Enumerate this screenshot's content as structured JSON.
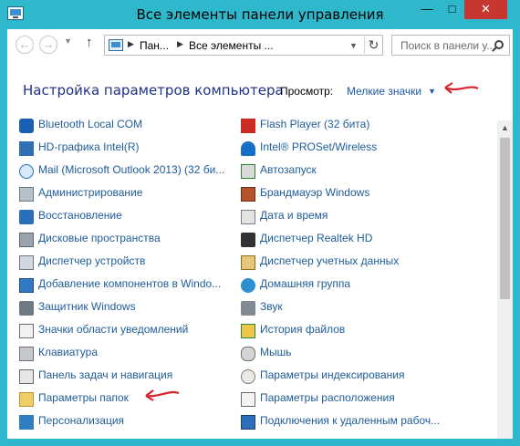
{
  "window": {
    "title": "Все элементы панели управления",
    "controls": {
      "minimize": "—",
      "maximize": "□",
      "close": "✕"
    }
  },
  "addressbar": {
    "crumbs": [
      "Пан...",
      "Все элементы ..."
    ],
    "search_placeholder": "Поиск в панели у..."
  },
  "header": {
    "title": "Настройка параметров компьютера",
    "view_label": "Просмотр:",
    "view_value": "Мелкие значки"
  },
  "items_left": [
    {
      "label": "Bluetooth Local COM",
      "icon": "bluetooth-icon"
    },
    {
      "label": "HD-графика Intel(R)",
      "icon": "intel-graphics-icon"
    },
    {
      "label": "Mail (Microsoft Outlook 2013) (32 би...",
      "icon": "mail-icon"
    },
    {
      "label": "Администрирование",
      "icon": "administrative-tools-icon"
    },
    {
      "label": "Восстановление",
      "icon": "recovery-icon"
    },
    {
      "label": "Дисковые пространства",
      "icon": "storage-spaces-icon"
    },
    {
      "label": "Диспетчер устройств",
      "icon": "device-manager-icon"
    },
    {
      "label": "Добавление компонентов в Windo...",
      "icon": "add-features-icon"
    },
    {
      "label": "Защитник Windows",
      "icon": "windows-defender-icon"
    },
    {
      "label": "Значки области уведомлений",
      "icon": "notification-area-icon"
    },
    {
      "label": "Клавиатура",
      "icon": "keyboard-icon"
    },
    {
      "label": "Панель задач и навигация",
      "icon": "taskbar-icon"
    },
    {
      "label": "Параметры папок",
      "icon": "folder-options-icon"
    },
    {
      "label": "Персонализация",
      "icon": "personalization-icon"
    }
  ],
  "items_right": [
    {
      "label": "Flash Player (32 бита)",
      "icon": "flash-player-icon"
    },
    {
      "label": "Intel® PROSet/Wireless",
      "icon": "wireless-icon"
    },
    {
      "label": "Автозапуск",
      "icon": "autoplay-icon"
    },
    {
      "label": "Брандмауэр Windows",
      "icon": "firewall-icon"
    },
    {
      "label": "Дата и время",
      "icon": "date-time-icon"
    },
    {
      "label": "Диспетчер Realtek HD",
      "icon": "realtek-icon"
    },
    {
      "label": "Диспетчер учетных данных",
      "icon": "credential-manager-icon"
    },
    {
      "label": "Домашняя группа",
      "icon": "homegroup-icon"
    },
    {
      "label": "Звук",
      "icon": "sound-icon"
    },
    {
      "label": "История файлов",
      "icon": "file-history-icon"
    },
    {
      "label": "Мышь",
      "icon": "mouse-icon"
    },
    {
      "label": "Параметры индексирования",
      "icon": "indexing-options-icon"
    },
    {
      "label": "Параметры расположения",
      "icon": "location-settings-icon"
    },
    {
      "label": "Подключения к удаленным рабоч...",
      "icon": "remote-desktop-icon"
    }
  ],
  "colors": {
    "frame": "#2fb7cc",
    "close": "#c7372f",
    "title_blue": "#1e3287",
    "link_blue": "#1f5c99",
    "annotation_red": "#d9232d"
  }
}
